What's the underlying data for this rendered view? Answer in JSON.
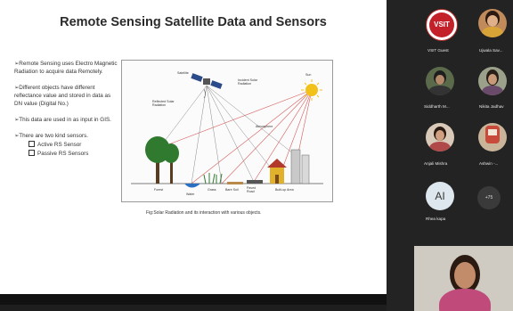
{
  "slide": {
    "title": "Remote Sensing Satellite Data and Sensors",
    "bullets": [
      "Remote Sensing uses Electro Magnetic Radiation to acquire data Remotely.",
      "Different objects have different reflectance value and stored in data as DN value (Digital No.)",
      "This data are used in as input in GIS.",
      "There are two kind sensors."
    ],
    "sub_bullets": [
      "Active RS Sensor",
      "Passive RS Sensors"
    ],
    "bullet_marker": "➢",
    "diagram": {
      "labels": {
        "satellite": "Satellite",
        "sun": "Sun",
        "reflected": "Reflected Solar Radiation",
        "incident": "Incident Solar Radiation",
        "atmosphere": "Atmosphere",
        "forest": "Forest",
        "water": "Water",
        "grass": "Grass",
        "bare_soil": "Bare Soil",
        "paved_road": "Paved Road",
        "built_up": "Built-up Area"
      },
      "caption": "Fig:Solar Radiation and its interaction with various objects."
    }
  },
  "participants": [
    {
      "name": "VSIT Guest",
      "logo_text": "VSIT"
    },
    {
      "name": "Ujwala Sav..."
    },
    {
      "name": "Siddharth M..."
    },
    {
      "name": "Nikita Jadhav"
    },
    {
      "name": "Anjali Mishra"
    },
    {
      "name": "Ashwin -..."
    },
    {
      "name": "Rhea kapa",
      "initials": "AI"
    }
  ],
  "more_count": "+75",
  "colors": {
    "slide_bg": "#ffffff",
    "sidebar_bg": "#232323",
    "sun": "#f2c21b",
    "ray": "#d55a5a",
    "tree": "#2f7a2f"
  }
}
